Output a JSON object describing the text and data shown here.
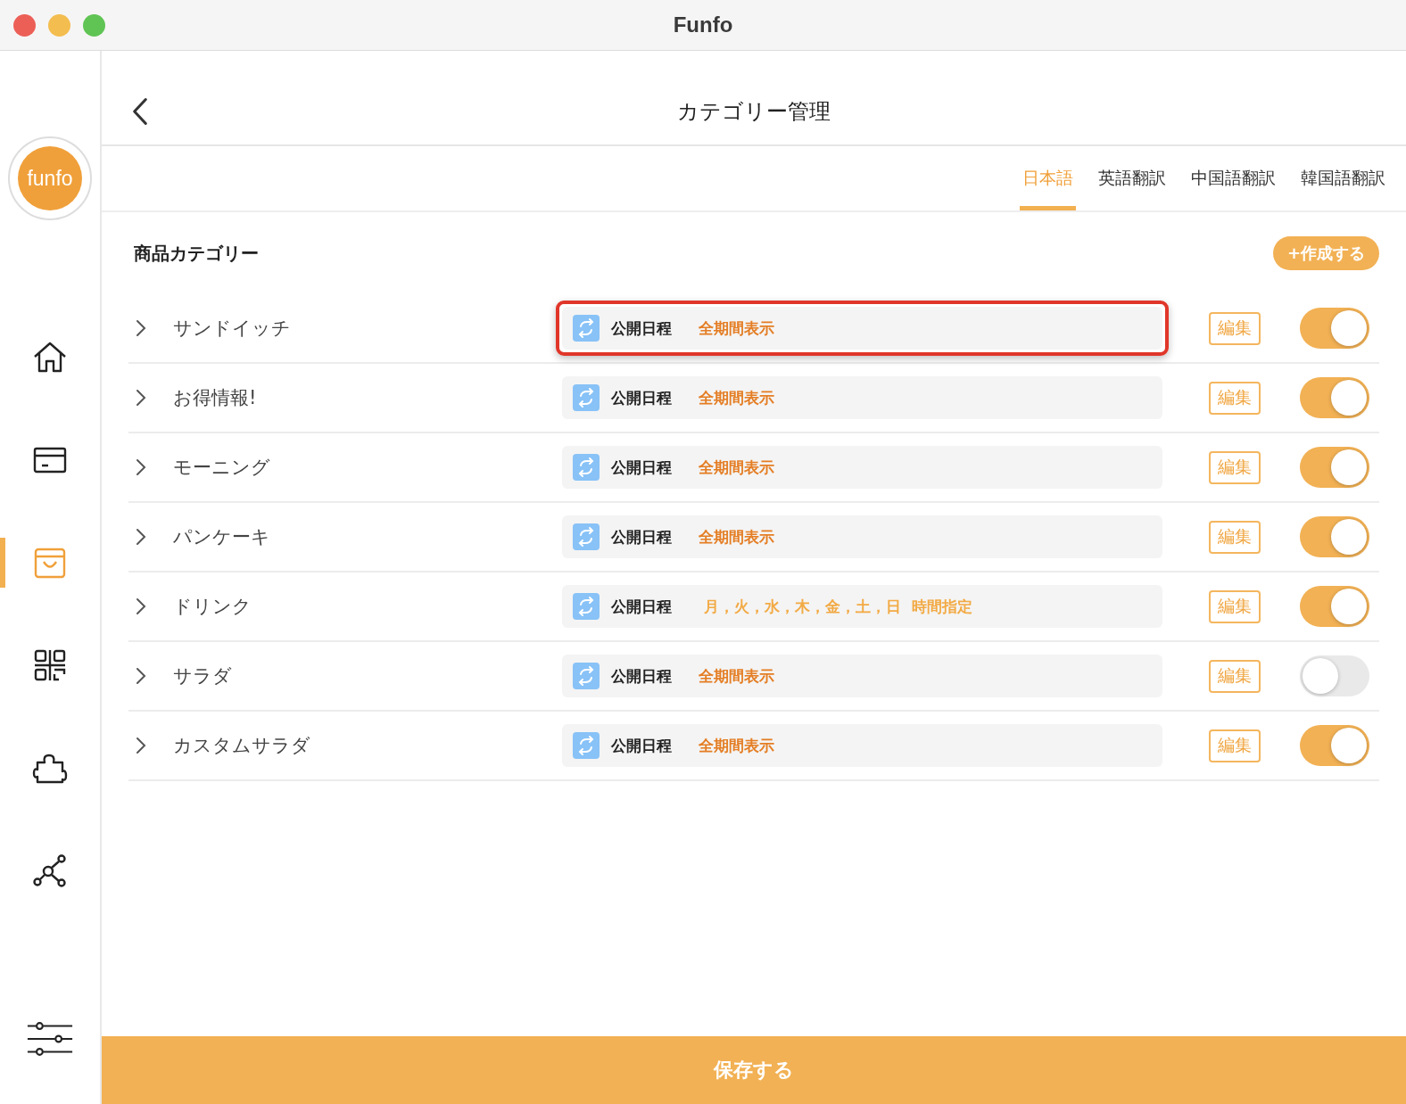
{
  "window": {
    "title": "Funfo"
  },
  "sidebar": {
    "logo": "funfo",
    "items": [
      {
        "kind": "home",
        "selected": false
      },
      {
        "kind": "card",
        "selected": false
      },
      {
        "kind": "bag",
        "selected": true
      },
      {
        "kind": "qr",
        "selected": false
      },
      {
        "kind": "puzzle",
        "selected": false
      },
      {
        "kind": "network",
        "selected": false
      }
    ],
    "bottom": {
      "kind": "sliders",
      "selected": false
    }
  },
  "header": {
    "title": "カテゴリー管理"
  },
  "tabs": [
    {
      "label": "日本語",
      "selected": true
    },
    {
      "label": "英語翻訳",
      "selected": false
    },
    {
      "label": "中国語翻訳",
      "selected": false
    },
    {
      "label": "韓国語翻訳",
      "selected": false
    }
  ],
  "section": {
    "title": "商品カテゴリー",
    "create_button": "+作成する"
  },
  "categories": [
    {
      "name": "サンドイッチ",
      "schedule_label": "公開日程",
      "schedule": "全期間表示",
      "kind": "all",
      "edit": "編集",
      "on": true,
      "highlighted": true
    },
    {
      "name": "お得情報!",
      "schedule_label": "公開日程",
      "schedule": "全期間表示",
      "kind": "all",
      "edit": "編集",
      "on": true,
      "highlighted": false
    },
    {
      "name": "モーニング",
      "schedule_label": "公開日程",
      "schedule": "全期間表示",
      "kind": "all",
      "edit": "編集",
      "on": true,
      "highlighted": false
    },
    {
      "name": "パンケーキ",
      "schedule_label": "公開日程",
      "schedule": "全期間表示",
      "kind": "all",
      "edit": "編集",
      "on": true,
      "highlighted": false
    },
    {
      "name": "ドリンク",
      "schedule_label": "公開日程",
      "schedule": "月，火，水，木，金，土，日 時間指定",
      "kind": "days",
      "edit": "編集",
      "on": true,
      "highlighted": false
    },
    {
      "name": "サラダ",
      "schedule_label": "公開日程",
      "schedule": "全期間表示",
      "kind": "all",
      "edit": "編集",
      "on": false,
      "highlighted": false
    },
    {
      "name": "カスタムサラダ",
      "schedule_label": "公開日程",
      "schedule": "全期間表示",
      "kind": "all",
      "edit": "編集",
      "on": true,
      "highlighted": false
    }
  ],
  "save_button": "保存する"
}
